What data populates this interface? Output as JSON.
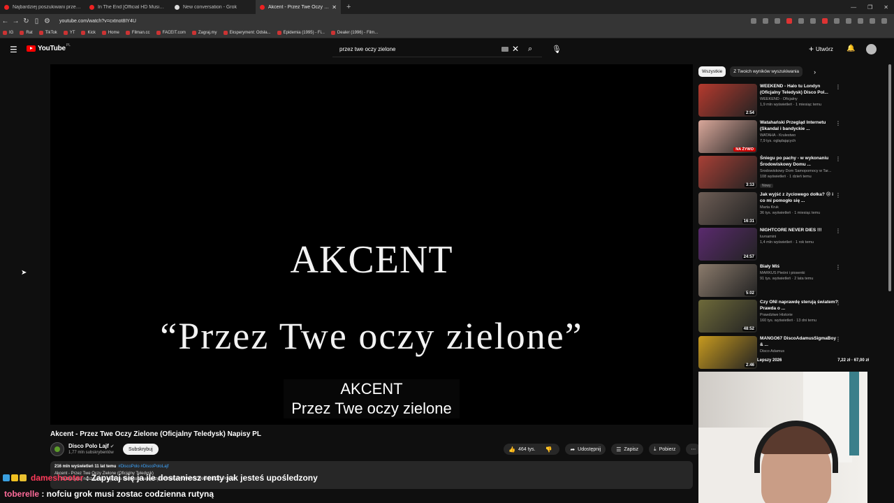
{
  "browser": {
    "tabs": [
      {
        "label": "Najbardziej poszukiwani przestępcy",
        "active": false
      },
      {
        "label": "In The End [Official HD Music Video]",
        "active": false
      },
      {
        "label": "New conversation - Grok",
        "active": false
      },
      {
        "label": "Akcent - Przez Twe Oczy Zie",
        "active": true
      }
    ],
    "new_tab": "+",
    "url": "youtube.com/watch?v=cxtnot8IY4U",
    "bookmarks": [
      "IG",
      "Rat",
      "TikTok",
      "YT",
      "Kick",
      "Home",
      "Filman.cc",
      "FACEIT.com",
      "Zagraj.my",
      "Eksperyment: Odsła...",
      "Epidemia (1995) - Fi...",
      "Dealer (1996) - Film..."
    ]
  },
  "youtube": {
    "logo_text": "YouTube",
    "logo_country": "PL",
    "search_value": "przez twe oczy zielone",
    "create_label": "Utwórz"
  },
  "player": {
    "title_text": "AKCENT",
    "subtitle_text": "“Przez Twe oczy zielone”",
    "caption_line1": "AKCENT",
    "caption_line2": "Przez Twe oczy zielone"
  },
  "video": {
    "title": "Akcent - Przez Twe Oczy Zielone (Oficjalny Teledysk) Napisy PL",
    "channel": "Disco Polo Lajf",
    "subscribers": "1,77 mln subskrybentów",
    "subscribe_label": "Subskrybuj",
    "likes": "464 tys.",
    "share_label": "Udostępnij",
    "save_label": "Zapisz",
    "download_label": "Pobierz",
    "views_line": "216 mln wyświetleń  11 lat temu",
    "tags": "#DiscoPolo #DiscoPoloLajf",
    "desc_line2": "Akcent - Przez Twe Oczy Zielone (Oficjalny Teledysk)",
    "desc_line3": "Subskrybuj nasz kanał i bądź na bieżąco z najlepszymi hitami i NOWOŚCIAMI DISCO POLO!"
  },
  "chat": {
    "msg1_nick": "dameshooter",
    "msg1_text": ": Zapytaj się ja ile dostaniesz renty jak jesteś upośledzony",
    "msg2_nick": "toberelle",
    "msg2_text": " : nofciu grok musi zostac codzienna rutyną"
  },
  "sidebar": {
    "chips": [
      "Wszystkie",
      "Z Twoich wyników wyszukiwania"
    ],
    "recommendations": [
      {
        "title": "WEEKEND - Halo tu Londyn (Oficjalny Teledysk) Disco Pol...",
        "channel": "WEEKEND - Oficjalny",
        "stats": "1,9 mln wyświetleń · 1 miesiąc temu",
        "duration": "2:54",
        "badge": "",
        "thumb_color": "#b53a2e"
      },
      {
        "title": "Watahański Przegląd Internetu (Skandal i bandyckie ...",
        "channel": "WATAHA - Krulestwo",
        "stats": "7,9 tys. oglądających",
        "duration": "",
        "live": "NA ŻYWO",
        "badge": "",
        "thumb_color": "#d9a79a"
      },
      {
        "title": "Śniegu po pachy - w wykonaniu Środowiskowy Domu ...",
        "channel": "Środowiskowy Dom Samopomocy w Tar...",
        "stats": "108 wyświetleń · 1 dzień temu",
        "duration": "3:13",
        "badge": "Nowy",
        "thumb_color": "#a84036"
      },
      {
        "title": "Jak wyjść z życiowego dołka? 😢 i co mi pomogło się ...",
        "channel": "Marta Kruk",
        "stats": "36 tys. wyświetleń · 1 miesiąc temu",
        "duration": "16:31",
        "badge": "",
        "thumb_color": "#6d5d55"
      },
      {
        "title": "NIGHTCORE NEVER DIES !!!",
        "channel": "luvnamini",
        "stats": "1,4 mln wyświetleń · 1 rok temu",
        "duration": "24:57",
        "badge": "",
        "thumb_color": "#5a2a6e"
      },
      {
        "title": "Biały Miś",
        "channel": "MARKUS Pieśni i piosenki",
        "stats": "91 tys. wyświetleń · 2 lata temu",
        "duration": "5:02",
        "badge": "",
        "thumb_color": "#8b7b6c"
      },
      {
        "title": "Czy ONI naprawdę sterują światem? Prawda o ...",
        "channel": "Prawdziwe Historie",
        "stats": "160 tys. wyświetleń · 13 dni temu",
        "duration": "48:52",
        "badge": "",
        "thumb_color": "#6e6a3a"
      },
      {
        "title": "MANGO67 DiscoAdamusSigmaBoy  & ...",
        "channel": "Disco Adamus",
        "stats": "",
        "duration": "2:46",
        "badge": "",
        "thumb_color": "#c79a1f"
      }
    ],
    "ticker_left": "Lepszy 2026",
    "ticker_right": "7,22 zł · 67,00 zł"
  }
}
